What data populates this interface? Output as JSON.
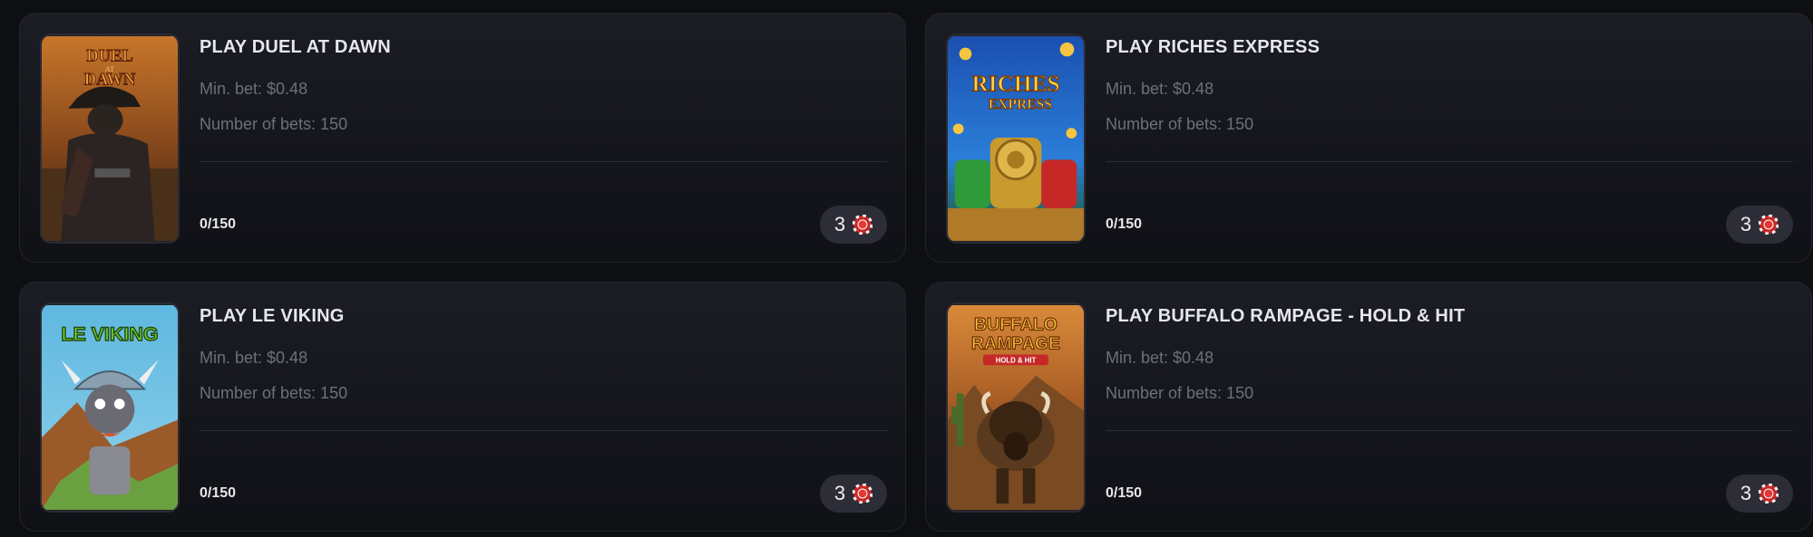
{
  "games": [
    {
      "title": "PLAY DUEL AT DAWN",
      "min_bet": "Min. bet: $0.48",
      "num_bets": "Number of bets: 150",
      "progress": "0/150",
      "badge_count": "3",
      "badge_icon": "poker-chip-icon",
      "logo_text_1": "DUEL",
      "logo_text_2": "AT",
      "logo_text_3": "DAWN"
    },
    {
      "title": "PLAY RICHES EXPRESS",
      "min_bet": "Min. bet: $0.48",
      "num_bets": "Number of bets: 150",
      "progress": "0/150",
      "badge_count": "3",
      "badge_icon": "poker-chip-icon",
      "logo_text_1": "RICHES",
      "logo_text_2": "EXPRESS"
    },
    {
      "title": "PLAY LE VIKING",
      "min_bet": "Min. bet: $0.48",
      "num_bets": "Number of bets: 150",
      "progress": "0/150",
      "badge_count": "3",
      "badge_icon": "poker-chip-icon",
      "logo_text_1": "LE VIKING"
    },
    {
      "title": "PLAY BUFFALO RAMPAGE - HOLD & HIT",
      "min_bet": "Min. bet: $0.48",
      "num_bets": "Number of bets: 150",
      "progress": "0/150",
      "badge_count": "3",
      "badge_icon": "poker-chip-icon",
      "logo_text_1": "BUFFALO",
      "logo_text_2": "RAMPAGE",
      "logo_text_3": "HOLD & HIT"
    }
  ],
  "colors": {
    "card_bg": "#1c1d24",
    "title": "#e6e7ec",
    "meta": "#6d6f7a",
    "badge_bg": "#2c2d37",
    "chip_red": "#c62828"
  }
}
